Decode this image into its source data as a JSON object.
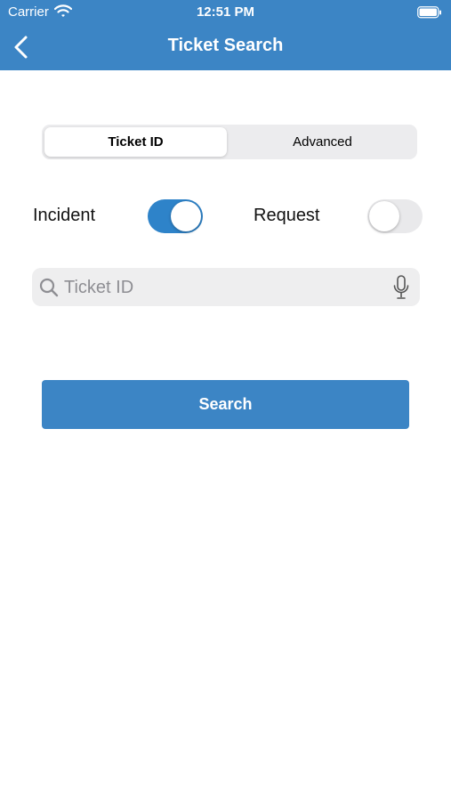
{
  "status_bar": {
    "carrier": "Carrier",
    "time": "12:51 PM",
    "wifi_icon": "wifi-icon",
    "battery_icon": "battery-icon"
  },
  "nav": {
    "title": "Ticket Search",
    "back_icon": "chevron-left-icon"
  },
  "segments": [
    {
      "label": "Ticket ID",
      "selected": true
    },
    {
      "label": "Advanced",
      "selected": false
    }
  ],
  "toggles": [
    {
      "label": "Incident",
      "on": true
    },
    {
      "label": "Request",
      "on": false
    }
  ],
  "search": {
    "placeholder": "Ticket ID",
    "value": "",
    "icon": "search-icon",
    "mic_icon": "microphone-icon"
  },
  "search_button": {
    "label": "Search"
  },
  "colors": {
    "header": "#3c85c5",
    "switch_on": "#2e83c9",
    "switch_off": "#e9e9eb",
    "button": "#3c85c5"
  }
}
